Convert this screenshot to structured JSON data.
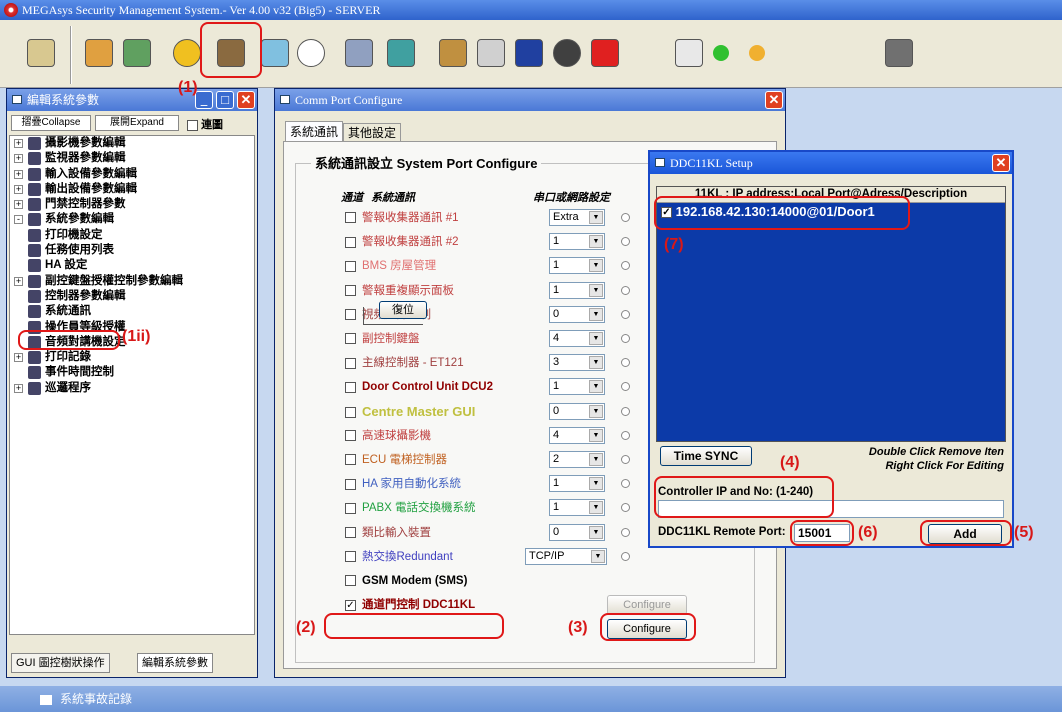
{
  "window_title": "MEGAsys Security Management System.- Ver 4.00 v32  (Big5)  - SERVER",
  "panel": {
    "title": "編輯系統參數",
    "collapse": "摺疊Collapse",
    "expand": "展開Expand",
    "link_label": "連圖",
    "tree": [
      {
        "label": "攝影機參數編輯",
        "plus": "+"
      },
      {
        "label": "監視器參數編輯",
        "plus": "+"
      },
      {
        "label": "輸入設備參數編輯",
        "plus": "+"
      },
      {
        "label": "輸出設備參數編輯",
        "plus": "+"
      },
      {
        "label": "門禁控制器參數",
        "plus": "+"
      },
      {
        "label": "系統參數編輯",
        "plus": "-"
      },
      {
        "label": "打印機設定",
        "plus": ""
      },
      {
        "label": "任務使用列表",
        "plus": ""
      },
      {
        "label": "HA 設定",
        "plus": ""
      },
      {
        "label": "副控鍵盤授權控制參數編輯",
        "plus": "+"
      },
      {
        "label": "控制器參數編輯",
        "plus": ""
      },
      {
        "label": "系統通訊",
        "plus": ""
      },
      {
        "label": "操作員等級授權",
        "plus": ""
      },
      {
        "label": "音頻對講機設定",
        "plus": ""
      },
      {
        "label": "打印記錄",
        "plus": "+"
      },
      {
        "label": "事件時間控制",
        "plus": ""
      },
      {
        "label": "巡邏程序",
        "plus": "+"
      }
    ],
    "tab1": "GUI 圖控樹狀操作",
    "tab2": "編輯系統參數"
  },
  "comm": {
    "title": "Comm Port Configure",
    "tab1": "系統通訊",
    "tab2": "其他設定",
    "group": "系統通訊設立 System Port Configure",
    "col1": "通道",
    "col2": "系統通訊",
    "col3": "串口或網路設定",
    "rows": [
      {
        "label": "警報收集器通訊 #1",
        "checked": false,
        "color": "#c04040",
        "bold": false,
        "port": "Extra"
      },
      {
        "label": "警報收集器通訊 #2",
        "checked": false,
        "color": "#c04040",
        "bold": false,
        "port": "1"
      },
      {
        "label": "BMS 房屋管理",
        "checked": false,
        "color": "#e07070",
        "bold": false,
        "port": "1"
      },
      {
        "label": "警報重複顯示面板",
        "checked": false,
        "color": "#c04040",
        "bold": false,
        "port": "1"
      },
      {
        "label": "視頻矩陣控制",
        "checked": false,
        "color": "#a04040",
        "bold": false,
        "port": "0"
      },
      {
        "label": "副控制鍵盤",
        "checked": false,
        "color": "#c04040",
        "bold": false,
        "port": "4"
      },
      {
        "label": "主線控制器 - ET121",
        "checked": false,
        "color": "#a04040",
        "bold": false,
        "port": "3"
      },
      {
        "label": "Door Control Unit DCU2",
        "checked": false,
        "color": "#900000",
        "bold": true,
        "port": "1"
      },
      {
        "label": "Centre Master GUI",
        "checked": false,
        "color": "#c0c040",
        "bold": true,
        "port": "0"
      },
      {
        "label": "高速球攝影機",
        "checked": false,
        "color": "#c04040",
        "bold": false,
        "port": "4"
      },
      {
        "label": "ECU 電梯控制器",
        "checked": false,
        "color": "#c06020",
        "bold": false,
        "port": "2"
      },
      {
        "label": "HA 家用自動化系統",
        "checked": false,
        "color": "#4060c0",
        "bold": false,
        "port": "1"
      },
      {
        "label": "PABX 電話交換機系統",
        "checked": false,
        "color": "#20a040",
        "bold": false,
        "port": "1"
      },
      {
        "label": "類比輸入裝置",
        "checked": false,
        "color": "#a04040",
        "bold": false,
        "port": "0"
      },
      {
        "label": "熱交換Redundant",
        "checked": false,
        "color": "#4040c0",
        "bold": false,
        "port": "TCP/IP"
      },
      {
        "label": "GSM Modem (SMS)",
        "checked": false,
        "color": "#000000",
        "bold": true,
        "port": ""
      },
      {
        "label": "通道門控制 DDC11KL",
        "checked": true,
        "color": "#900000",
        "bold": true,
        "port": ""
      }
    ],
    "reset": "復位",
    "configure_disabled": "Configure",
    "configure": "Configure"
  },
  "ddc": {
    "title": "DDC11KL Setup",
    "header": "11KL : IP address:Local Port@Adress/Description",
    "item": "192.168.42.130:14000@01/Door1",
    "sync": "Time SYNC",
    "hint1": "Double Click Remove Iten",
    "hint2": "Right Click For Editing",
    "ip_label": "Controller IP  and No: (1-240)",
    "ip_value": "",
    "port_label": "DDC11KL Remote Port:",
    "port_value": "15001",
    "add": "Add"
  },
  "annot": {
    "a1": "(1)",
    "a1ii": "(1ii)",
    "a2": "(2)",
    "a3": "(3)",
    "a4": "(4)",
    "a5": "(5)",
    "a6": "(6)",
    "a7": "(7)"
  },
  "status_title": "系統事故記錄"
}
